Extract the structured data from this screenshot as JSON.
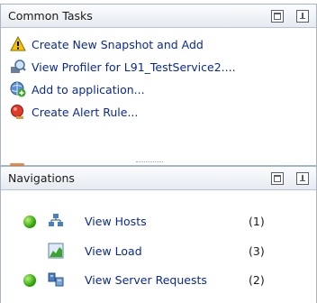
{
  "common_tasks": {
    "title": "Common Tasks",
    "items": [
      {
        "label": "Create New Snapshot and Add",
        "icon": "warning-icon"
      },
      {
        "label": "View Profiler for L91_TestService2....",
        "icon": "profiler-icon"
      },
      {
        "label": "Add to application...",
        "icon": "globe-add-icon"
      },
      {
        "label": "Create Alert Rule...",
        "icon": "alert-rule-icon"
      }
    ]
  },
  "navigations": {
    "title": "Navigations",
    "items": [
      {
        "label": "View Hosts",
        "count": "(1)",
        "status": "green",
        "icon": "hosts-icon"
      },
      {
        "label": "View Load",
        "count": "(3)",
        "status": "none",
        "icon": "load-chart-icon"
      },
      {
        "label": "View Server Requests",
        "count": "(2)",
        "status": "green",
        "icon": "server-requests-icon"
      }
    ]
  },
  "colors": {
    "link": "#0a2a8f",
    "status_green": "#2fa60a",
    "header_bg": "#e6ebf1"
  }
}
